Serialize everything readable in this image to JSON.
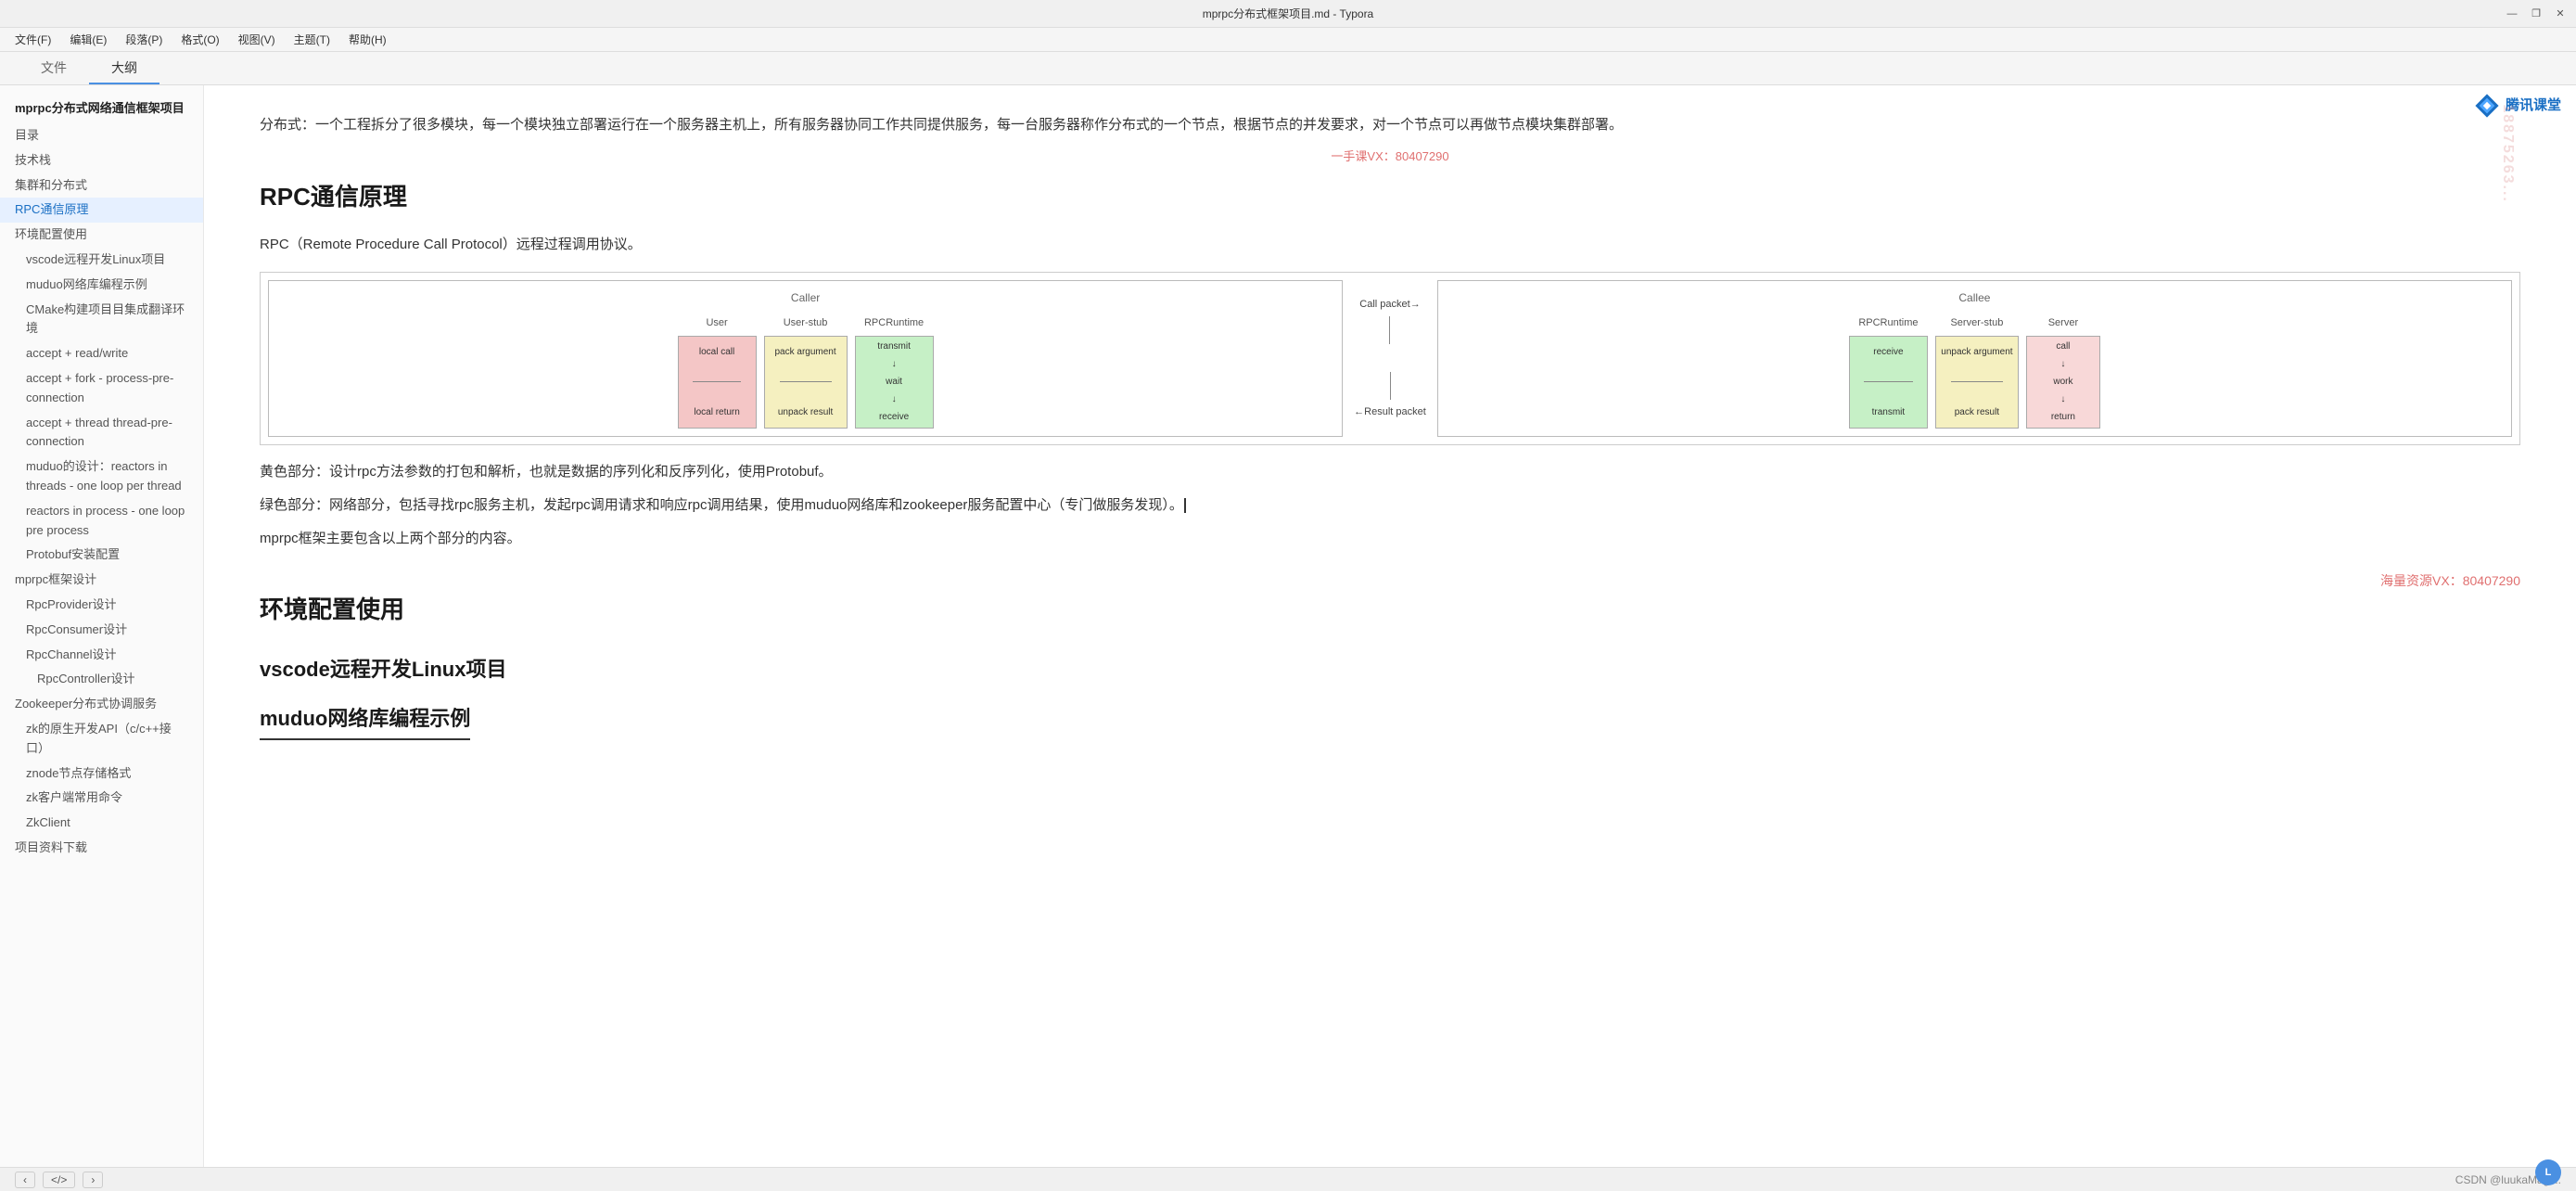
{
  "titlebar": {
    "title": "mprpc分布式框架项目.md - Typora",
    "min_label": "—",
    "restore_label": "❐",
    "close_label": "✕"
  },
  "menubar": {
    "items": [
      "文件(F)",
      "编辑(E)",
      "段落(P)",
      "格式(O)",
      "视图(V)",
      "主题(T)",
      "帮助(H)"
    ]
  },
  "tabs": {
    "file_label": "文件",
    "outline_label": "大纲"
  },
  "sidebar": {
    "project_title": "mprpc分布式网络通信框架项目",
    "items": [
      {
        "label": "目录",
        "indent": 1,
        "active": false
      },
      {
        "label": "技术栈",
        "indent": 1,
        "active": false
      },
      {
        "label": "集群和分布式",
        "indent": 1,
        "active": false
      },
      {
        "label": "RPC通信原理",
        "indent": 1,
        "active": true
      },
      {
        "label": "环境配置使用",
        "indent": 1,
        "active": false
      },
      {
        "label": "vscode远程开发Linux项目",
        "indent": 2,
        "active": false
      },
      {
        "label": "muduo网络库编程示例",
        "indent": 2,
        "active": false
      },
      {
        "label": "CMake构建项目目集成翻译环境",
        "indent": 2,
        "active": false
      },
      {
        "label": "accept + read/write",
        "indent": 2,
        "active": false
      },
      {
        "label": "accept + fork - process-pre-connection",
        "indent": 2,
        "active": false
      },
      {
        "label": "accept + thread thread-pre-connection",
        "indent": 2,
        "active": false
      },
      {
        "label": "muduo的设计：reactors in threads - one loop per thread",
        "indent": 2,
        "active": false
      },
      {
        "label": "reactors in process - one loop pre process",
        "indent": 2,
        "active": false
      },
      {
        "label": "Protobuf安装配置",
        "indent": 2,
        "active": false
      },
      {
        "label": "mprpc框架设计",
        "indent": 1,
        "active": false
      },
      {
        "label": "RpcProvider设计",
        "indent": 2,
        "active": false
      },
      {
        "label": "RpcConsumer设计",
        "indent": 2,
        "active": false
      },
      {
        "label": "RpcChannel设计",
        "indent": 2,
        "active": false
      },
      {
        "label": "RpcController设计",
        "indent": 3,
        "active": false
      },
      {
        "label": "Zookeeper分布式协调服务",
        "indent": 1,
        "active": false
      },
      {
        "label": "zk的原生开发API（c/c++接口）",
        "indent": 2,
        "active": false
      },
      {
        "label": "znode节点存储格式",
        "indent": 2,
        "active": false
      },
      {
        "label": "zk客户端常用命令",
        "indent": 2,
        "active": false
      },
      {
        "label": "ZkClient",
        "indent": 2,
        "active": false
      },
      {
        "label": "项目资料下载",
        "indent": 1,
        "active": false
      }
    ]
  },
  "content": {
    "intro_para": "分布式：一个工程拆分了很多模块，每一个模块独立部署运行在一个服务器主机上，所有服务器协同工作共同提供服务，每一台服务器称作分布式的一个节点，根据节点的并发要求，对一个节点可以再做节点模块集群部署。",
    "vx_watermark": "一手课VX：80407290",
    "rpc_heading": "RPC通信原理",
    "rpc_intro": "RPC（Remote Procedure Call Protocol）远程过程调用协议。",
    "diagram": {
      "caller_label": "Caller",
      "callee_label": "Callee",
      "caller_boxes": [
        {
          "label": "User",
          "content": "local call\n\n\nlocal return",
          "color": "pink"
        },
        {
          "label": "User-stub",
          "content": "pack argument\n\n\nunpack result",
          "color": "yellow"
        },
        {
          "label": "RPCRuntime",
          "content": "transmit\nwait\nreceive\n\n\n\n",
          "color": "green"
        }
      ],
      "callee_boxes": [
        {
          "label": "RPCRuntime",
          "content": "receive\n\n\ntransmit",
          "color": "green"
        },
        {
          "label": "Server-stub",
          "content": "unpack argument\n\n\npack result",
          "color": "yellow"
        },
        {
          "label": "Server",
          "content": "call\nwork\nreturn",
          "color": "light-pink"
        }
      ],
      "call_packet_label": "Call packet→",
      "result_packet_label": "←Result packet"
    },
    "yellow_para": "黄色部分：设计rpc方法参数的打包和解析，也就是数据的序列化和反序列化，使用Protobuf。",
    "green_para": "绿色部分：网络部分，包括寻找rpc服务主机，发起rpc调用请求和响应rpc调用结果，使用muduo网络库和zookeeper服务配置中心（专门做服务发现）。",
    "cursor_visible": true,
    "summary_para": "mprpc框架主要包含以上两个部分的内容。",
    "watermark_vx": "海量资源VX：80407290",
    "section2_heading": "环境配置使用",
    "section3_heading": "vscode远程开发Linux项目",
    "section4_heading_partial": "muduo网络库编程示例"
  },
  "bottombar": {
    "prev_label": "‹",
    "next_label": "›",
    "code_label": "</>",
    "source_info": "CSDN @luukaMagi..."
  },
  "tencent": {
    "logo_label": "腾讯课堂",
    "side_number": "18875263..."
  }
}
